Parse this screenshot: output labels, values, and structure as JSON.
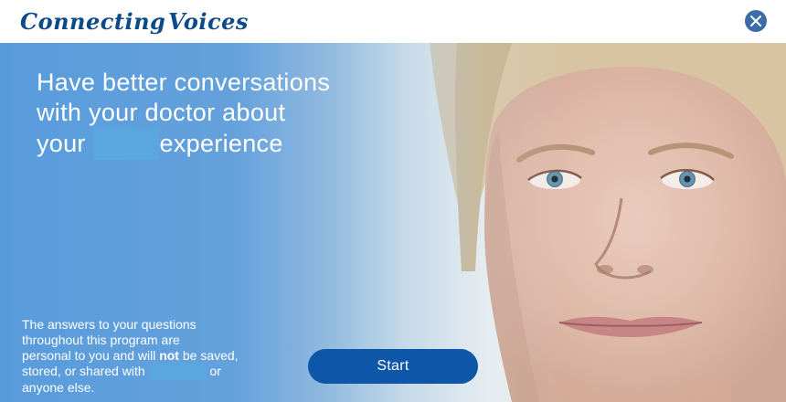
{
  "brand": {
    "word1": "Connecting",
    "word2": "Voices"
  },
  "close": {
    "icon": "close-icon"
  },
  "hero": {
    "headline_line1": "Have better conversations",
    "headline_line2": "with your doctor about",
    "headline_line3_before": "your",
    "headline_line3_after": "experience",
    "privacy_line1": "The answers to your questions",
    "privacy_line2": "throughout this program are",
    "privacy_line3_before": "personal to you and will",
    "privacy_line3_bold": "not",
    "privacy_line3_after": "be saved,",
    "privacy_line4_before": "stored, or shared with",
    "privacy_line4_after": "or",
    "privacy_line5": "anyone else."
  },
  "actions": {
    "start_label": "Start"
  },
  "colors": {
    "brand": "#0d4a8a",
    "button": "#0d56a8",
    "overlay_blue": "#589bdc",
    "redaction": "#5aa6e0",
    "close_button": "#3d6da8"
  }
}
